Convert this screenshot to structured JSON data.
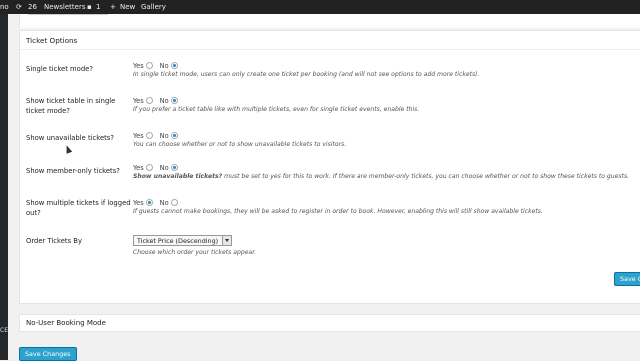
{
  "adminbar": {
    "site_fragment": "no",
    "updates_count": "26",
    "newsletters": "Newsletters",
    "comments_count": "1",
    "new_label": "New",
    "gallery": "Gallery"
  },
  "sidebar": {
    "fragment": "CE"
  },
  "ticket_options": {
    "title": "Ticket Options",
    "rows": [
      {
        "label": "Single ticket mode?",
        "yes": "Yes",
        "no": "No",
        "selected": "No",
        "desc": "In single ticket mode, users can only create one ticket per booking (and will not see options to add more tickets)."
      },
      {
        "label": "Show ticket table in single ticket mode?",
        "yes": "Yes",
        "no": "No",
        "selected": "No",
        "desc": "If you prefer a ticket table like with multiple tickets, even for single ticket events, enable this."
      },
      {
        "label": "Show unavailable tickets?",
        "yes": "Yes",
        "no": "No",
        "selected": "No",
        "desc": "You can choose whether or not to show unavailable tickets to visitors."
      },
      {
        "label": "Show member-only tickets?",
        "yes": "Yes",
        "no": "No",
        "selected": "No",
        "desc_bold": "Show unavailable tickets?",
        "desc": " must be set to yes for this to work. If there are member-only tickets, you can choose whether or not to show these tickets to guests."
      },
      {
        "label": "Show multiple tickets if logged out?",
        "yes": "Yes",
        "no": "No",
        "selected": "Yes",
        "desc": "If guests cannot make bookings, they will be asked to register in order to book. However, enabling this will still show available tickets."
      }
    ],
    "order": {
      "label": "Order Tickets By",
      "value": "Ticket Price (Descending)",
      "desc": "Choose which order your tickets appear."
    },
    "save_fragment": "Save Ch"
  },
  "no_user_booking": {
    "title": "No-User Booking Mode"
  },
  "save_button": "Save Changes"
}
